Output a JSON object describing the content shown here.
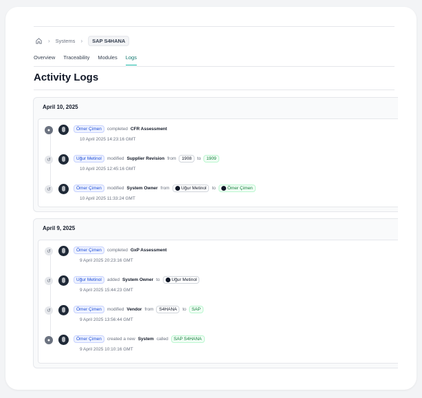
{
  "breadcrumb": {
    "home_icon": "home-icon",
    "systems": "Systems",
    "current": "SAP S4HANA"
  },
  "tabs": [
    {
      "label": "Overview",
      "active": false
    },
    {
      "label": "Traceability",
      "active": false
    },
    {
      "label": "Modules",
      "active": false
    },
    {
      "label": "Logs",
      "active": true
    }
  ],
  "page": {
    "title": "Activity Logs"
  },
  "groups": [
    {
      "date": "April 10, 2025",
      "entries": [
        {
          "icon": "dot-icon",
          "user": "Ömer Çimen",
          "action": "completed",
          "object": "CFR Assessment",
          "timestamp": "10 April 2025 14:23:16 GMT"
        },
        {
          "icon": "history-icon",
          "user": "Uğur Metinol",
          "action": "modified",
          "object": "Supplier Revision",
          "from_label": "from",
          "from": "1908",
          "to_label": "to",
          "to": "1909",
          "timestamp": "10 April 2025 12:45:16 GMT"
        },
        {
          "icon": "history-icon",
          "user": "Ömer Çimen",
          "action": "modified",
          "object": "System Owner",
          "from_label": "from",
          "from": "Uğur Metinol",
          "to_label": "to",
          "to": "Ömer Çimen",
          "timestamp": "10 April 2025 11:33:24 GMT"
        }
      ]
    },
    {
      "date": "April 9, 2025",
      "entries": [
        {
          "icon": "history-icon",
          "user": "Ömer Çimen",
          "action": "completed",
          "object": "GxP Assessment",
          "timestamp": "9 April 2025 20:23:16 GMT"
        },
        {
          "icon": "history-icon",
          "user": "Uğur Metinol",
          "action": "added",
          "object": "System Owner",
          "to_label": "to",
          "to": "Uğur Metinol",
          "timestamp": "9 April 2025 15:44:23 GMT"
        },
        {
          "icon": "history-icon",
          "user": "Ömer Çimen",
          "action": "modified",
          "object": "Vendor",
          "from_label": "from",
          "from": "S4HANA",
          "to_label": "to",
          "to": "SAP",
          "timestamp": "9 April 2025 13:56:44 GMT"
        },
        {
          "icon": "dot-icon",
          "user": "Ömer Çimen",
          "action": "created a new",
          "object": "System",
          "called_label": "called",
          "called": "SAP S4HANA",
          "timestamp": "9 April 2025 10:10:16 GMT"
        }
      ]
    }
  ]
}
